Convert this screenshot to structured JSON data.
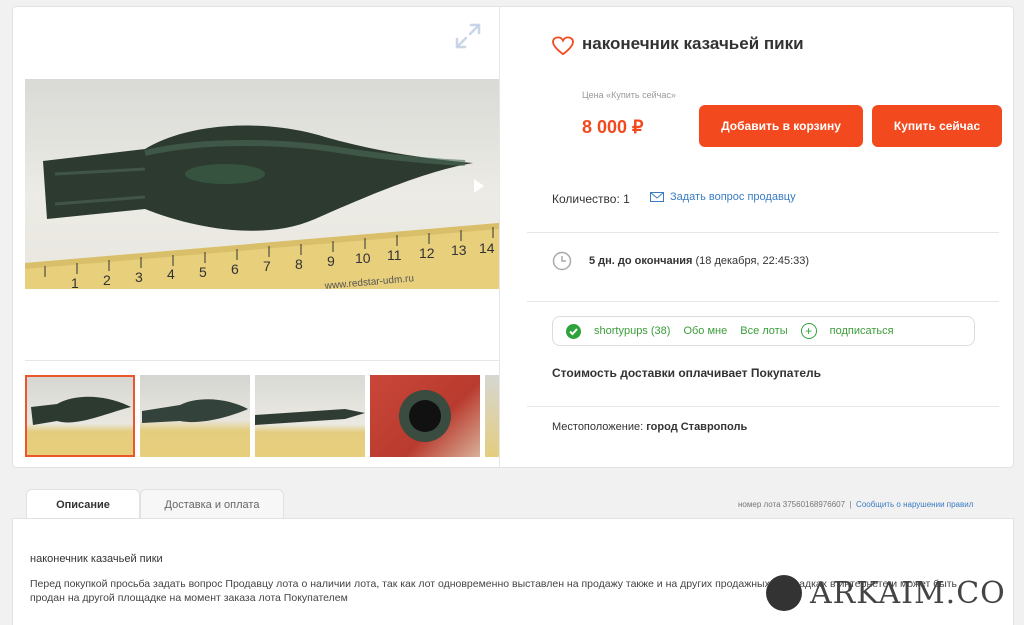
{
  "listing": {
    "title": "наконечник казачьей пики",
    "price_label": "Цена «Купить сейчас»",
    "price": "8 000 ₽",
    "add_to_cart": "Добавить в корзину",
    "buy_now": "Купить сейчас",
    "quantity": "Количество: 1",
    "ask_seller": "Задать вопрос продавцу",
    "time_left": "5 дн. до окончания",
    "end_date": "(18 декабря, 22:45:33)",
    "seller": {
      "name": "shortypups (38)",
      "about": "Обо мне",
      "all_lots": "Все лоты",
      "subscribe": "подписаться"
    },
    "delivery_note": "Стоимость доставки оплачивает Покупатель",
    "location_label": "Местоположение:",
    "location_value": "город Ставрополь"
  },
  "gallery": {
    "ruler_text": "www.redstar-udm.ru",
    "ruler_numbers": [
      "1",
      "2",
      "3",
      "4",
      "5",
      "6",
      "7",
      "8",
      "9",
      "10",
      "11",
      "12",
      "13",
      "14"
    ]
  },
  "tabs": [
    {
      "label": "Описание",
      "active": true
    },
    {
      "label": "Доставка и оплата",
      "active": false
    }
  ],
  "lot_meta": {
    "lot_number": "номер лота 37560168976607",
    "separator": "|",
    "report": "Сообщить о нарушении правил"
  },
  "description": {
    "title": "наконечник казачьей пики",
    "text": "Перед покупкой просьба задать вопрос Продавцу лота о наличии лота, так как лот одновременно выставлен на продажу также и на других продажных площадках в интернете и может быть продан на другой площадке на момент заказа лота Покупателем"
  },
  "watermark": "ARKAIM.CO",
  "colors": {
    "accent": "#f2491e",
    "link": "#3a7cc2",
    "seller_green": "#2fa33b"
  }
}
